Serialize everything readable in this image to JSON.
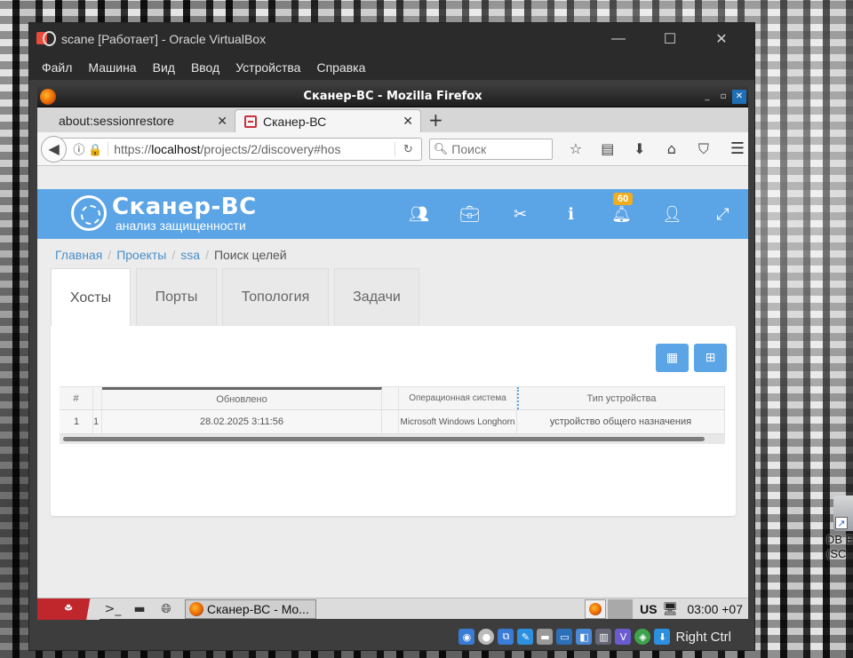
{
  "vbox": {
    "title": "scane [Работает] - Oracle VirtualBox",
    "window_controls": [
      "—",
      "☐",
      "✕"
    ],
    "menu": [
      "Файл",
      "Машина",
      "Вид",
      "Ввод",
      "Устройства",
      "Справка"
    ],
    "host_key": "Right Ctrl",
    "status_icons": [
      "disk-icon",
      "optical-icon",
      "network-icon",
      "usb-icon",
      "shared-folder-icon",
      "display-icon",
      "recording-icon",
      "mouse-icon",
      "keyboard-icon",
      "cpu-icon",
      "arrow-down-icon"
    ]
  },
  "firefox": {
    "title": "Сканер-ВС - Mozilla Firefox",
    "tabs": [
      {
        "label": "about:sessionrestore",
        "close": "✕"
      },
      {
        "label": "Сканер-ВС",
        "close": "✕"
      }
    ],
    "new_tab": "+",
    "url": {
      "prefix": "https://",
      "host": "localhost",
      "path": "/projects/2/discovery#hos"
    },
    "search_placeholder": "Поиск"
  },
  "app": {
    "brand_name": "Сканер-ВС",
    "brand_sub": "анализ защищенности",
    "notification_count": "60",
    "header_icons": [
      "users-icon",
      "briefcase-icon",
      "tools-icon",
      "info-icon",
      "bell-icon",
      "user-icon",
      "fullscreen-icon"
    ]
  },
  "breadcrumb": {
    "items": [
      "Главная",
      "Проекты",
      "ssa"
    ],
    "current": "Поиск целей",
    "separator": "/"
  },
  "tabs": [
    "Хосты",
    "Порты",
    "Топология",
    "Задачи"
  ],
  "grid": {
    "headers": {
      "num": "#",
      "updated": "Обновлено",
      "os": "Операционная система",
      "type": "Тип устройства"
    },
    "rows": [
      {
        "num": "1",
        "id": "1",
        "updated": "28.02.2025 3:11:56",
        "os": "Microsoft Windows Longhorn",
        "type": "устройство общего назначения"
      }
    ]
  },
  "guest_taskbar": {
    "task_label": "Сканер-ВС - Mo...",
    "lang": "US",
    "clock": "03:00 +07"
  },
  "desktop_icon": {
    "label_line1": "DB E",
    "label_line2": "(SC"
  }
}
